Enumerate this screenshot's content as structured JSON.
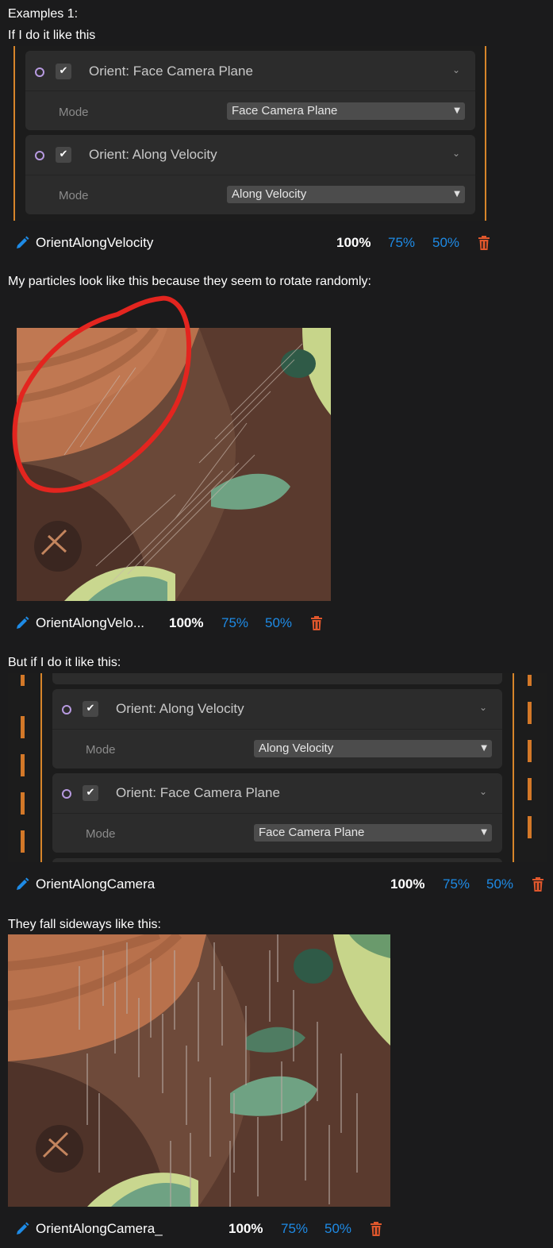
{
  "intro": {
    "line1": "Examples 1:",
    "line2": "If I do it like this"
  },
  "example1": {
    "blocks": [
      {
        "title": "Orient: Face Camera Plane",
        "mode_label": "Mode",
        "mode_value": "Face Camera Plane"
      },
      {
        "title": "Orient: Along Velocity",
        "mode_label": "Mode",
        "mode_value": "Along Velocity"
      }
    ],
    "attachment": {
      "name": "OrientAlongVelocity",
      "pct_full": "100%",
      "pct_75": "75%",
      "pct_50": "50%"
    }
  },
  "caption1": "My particles look like this because they seem to rotate randomly:",
  "image1": {
    "attachment": {
      "name": "OrientAlongVelo...",
      "pct_full": "100%",
      "pct_75": "75%",
      "pct_50": "50%"
    }
  },
  "caption2": "But if I do it like this:",
  "example2": {
    "blocks": [
      {
        "title": "Orient: Along Velocity",
        "mode_label": "Mode",
        "mode_value": "Along Velocity"
      },
      {
        "title": "Orient: Face Camera Plane",
        "mode_label": "Mode",
        "mode_value": "Face Camera Plane"
      }
    ],
    "attachment": {
      "name": "OrientAlongCamera",
      "pct_full": "100%",
      "pct_75": "75%",
      "pct_50": "50%"
    }
  },
  "caption3": "They fall sideways like this:",
  "image2": {
    "attachment": {
      "name": "OrientAlongCamera_",
      "pct_full": "100%",
      "pct_75": "75%",
      "pct_50": "50%"
    }
  },
  "icons": {
    "pencil": "pencil-icon",
    "trash": "trash-icon",
    "chevron": "chevron-down-icon",
    "check": "checkmark-icon",
    "circle": "circle-icon"
  },
  "colors": {
    "link": "#1e8be6",
    "trash": "#e0572c",
    "accent_line": "#d7852a",
    "annotation": "#e3251f"
  }
}
